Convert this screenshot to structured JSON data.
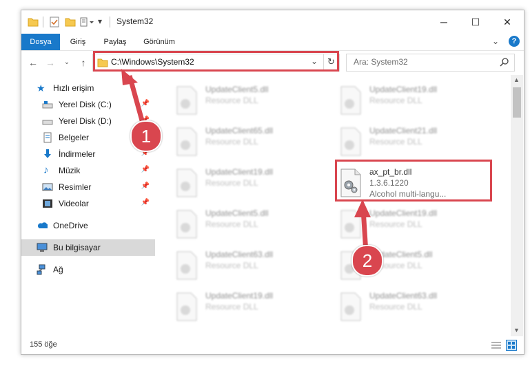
{
  "window": {
    "title": "System32"
  },
  "ribbon": {
    "tabs": [
      "Dosya",
      "Giriş",
      "Paylaş",
      "Görünüm"
    ]
  },
  "address": {
    "path": "C:\\Windows\\System32"
  },
  "search": {
    "placeholder": "Ara: System32"
  },
  "sidebar": {
    "quick_access": "Hızlı erişim",
    "items": [
      "Yerel Disk (C:)",
      "Yerel Disk (D:)",
      "Belgeler",
      "İndirmeler",
      "Müzik",
      "Resimler",
      "Videolar"
    ],
    "onedrive": "OneDrive",
    "this_pc": "Bu bilgisayar",
    "network": "Ağ"
  },
  "files": [
    {
      "name": "UpdateClient5.dll",
      "desc": "Resource DLL"
    },
    {
      "name": "UpdateClient19.dll",
      "desc": "Resource DLL"
    },
    {
      "name": "UpdateClient65.dll",
      "desc": "Resource DLL"
    },
    {
      "name": "UpdateClient21.dll",
      "desc": "Resource DLL"
    },
    {
      "name": "UpdateClient19.dll",
      "desc": "Resource DLL"
    },
    {
      "name": "ax_pt_br.dll",
      "version": "1.3.6.1220",
      "desc": "Alcohol multi-langu..."
    },
    {
      "name": "UpdateClient5.dll",
      "desc": "Resource DLL"
    },
    {
      "name": "UpdateClient19.dll",
      "desc": "Resource DLL"
    },
    {
      "name": "UpdateClient63.dll",
      "desc": "Resource DLL"
    },
    {
      "name": "UpdateClient5.dll",
      "desc": "Resource DLL"
    },
    {
      "name": "UpdateClient19.dll",
      "desc": "Resource DLL"
    },
    {
      "name": "UpdateClient63.dll",
      "desc": "Resource DLL"
    }
  ],
  "status": {
    "count": "155 öğe"
  },
  "annotations": {
    "step1": "1",
    "step2": "2"
  },
  "colors": {
    "accent": "#1979ca",
    "highlight": "#d9464f"
  }
}
